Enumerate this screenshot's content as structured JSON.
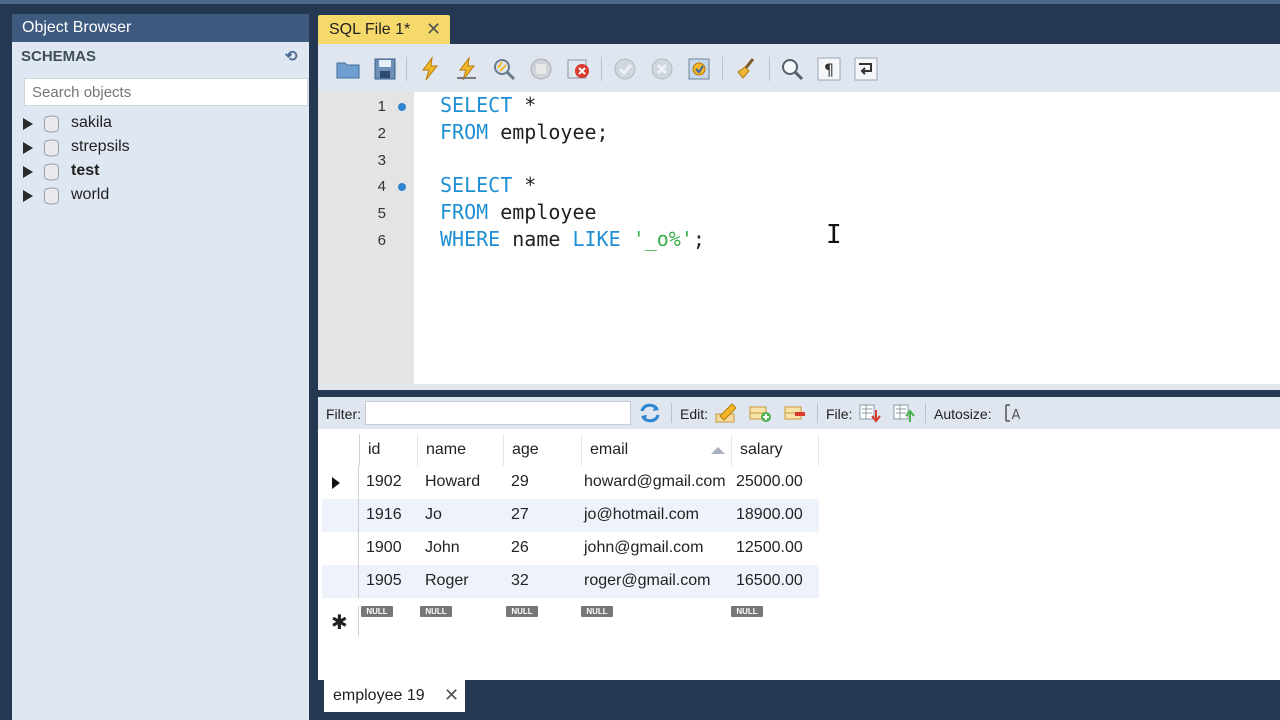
{
  "object_browser": {
    "title": "Object Browser",
    "schemas_label": "SCHEMAS",
    "search_placeholder": "Search objects",
    "schemas": [
      {
        "name": "sakila",
        "bold": false
      },
      {
        "name": "strepsils",
        "bold": false
      },
      {
        "name": "test",
        "bold": true
      },
      {
        "name": "world",
        "bold": false
      }
    ]
  },
  "editor": {
    "tab_label": "SQL File 1*",
    "tab_close": "✕",
    "lines": [
      {
        "num": "1",
        "breakpoint": true
      },
      {
        "num": "2",
        "breakpoint": false
      },
      {
        "num": "3",
        "breakpoint": false
      },
      {
        "num": "4",
        "breakpoint": true
      },
      {
        "num": "5",
        "breakpoint": false
      },
      {
        "num": "6",
        "breakpoint": false
      }
    ],
    "code": {
      "l1_kw": "SELECT",
      "l1_rest": " *",
      "l2_kw": "FROM",
      "l2_rest": " employee;",
      "l4_kw": "SELECT",
      "l4_rest": " *",
      "l5_kw": "FROM",
      "l5_rest": " employee",
      "l6_kw1": "WHERE",
      "l6_mid": " name ",
      "l6_kw2": "LIKE",
      "l6_sp": " ",
      "l6_str": "'_o%'",
      "l6_end": ";"
    }
  },
  "results": {
    "filter_label": "Filter:",
    "edit_label": "Edit:",
    "file_label": "File:",
    "autosize_label": "Autosize:",
    "columns": [
      "id",
      "name",
      "age",
      "email",
      "salary"
    ],
    "rows": [
      {
        "id": "1902",
        "name": "Howard",
        "age": "29",
        "email": "howard@gmail.com",
        "salary": "25000.00"
      },
      {
        "id": "1916",
        "name": "Jo",
        "age": "27",
        "email": "jo@hotmail.com",
        "salary": "18900.00"
      },
      {
        "id": "1900",
        "name": "John",
        "age": "26",
        "email": "john@gmail.com",
        "salary": "12500.00"
      },
      {
        "id": "1905",
        "name": "Roger",
        "age": "32",
        "email": "roger@gmail.com",
        "salary": "16500.00"
      }
    ],
    "null_label": "NULL",
    "new_row_marker": "✱",
    "result_tab_label": "employee 19",
    "result_tab_close": "✕"
  }
}
